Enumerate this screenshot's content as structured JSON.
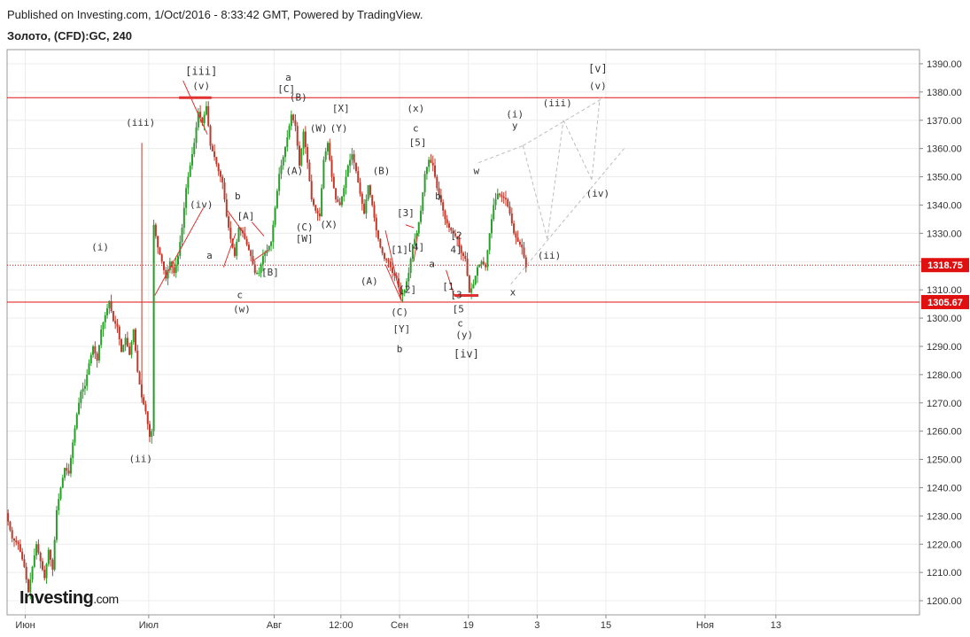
{
  "header": {
    "published": "Published on Investing.com, 1/Oct/2016 - 8:33:42 GMT, Powered by TradingView.",
    "symbol": "Золото, (CFD):GC, 240"
  },
  "logo": {
    "brand": "Investing",
    "suffix": ".com"
  },
  "colors": {
    "up": "#2a9d2a",
    "down": "#c0392b",
    "wave_line": "#e03030",
    "projection": "#bdbdbd",
    "price_tag": "#e01010",
    "grid": "#ececec",
    "axis": "#888888"
  },
  "chart_data": {
    "type": "candlestick",
    "ylim": [
      1195,
      1395
    ],
    "y_ticks": [
      1200,
      1210,
      1220,
      1230,
      1240,
      1250,
      1260,
      1270,
      1280,
      1290,
      1300,
      1310,
      1320,
      1330,
      1340,
      1350,
      1360,
      1370,
      1380,
      1390
    ],
    "y_tick_labels": [
      "1200.00",
      "1210.00",
      "1220.00",
      "1230.00",
      "1240.00",
      "1250.00",
      "1260.00",
      "1270.00",
      "1280.00",
      "1290.00",
      "1300.00",
      "1310.00",
      "1320.00",
      "1330.00",
      "1340.00",
      "1350.00",
      "1360.00",
      "1370.00",
      "1380.00",
      "1390.00"
    ],
    "x_labels": [
      {
        "label": "Июн",
        "x": 0.0
      },
      {
        "label": "Июл",
        "x": 30.5
      },
      {
        "label": "Авг",
        "x": 61.5
      },
      {
        "label": "12:00",
        "x": 78.0
      },
      {
        "label": "Сен",
        "x": 92.5
      },
      {
        "label": "19",
        "x": 109.5
      },
      {
        "label": "3",
        "x": 126.5
      },
      {
        "label": "15",
        "x": 143.5
      },
      {
        "label": "Ноя",
        "x": 168.0
      },
      {
        "label": "13",
        "x": 185.5
      }
    ],
    "x_range": [
      -4.5,
      221
    ],
    "price_path": [
      [
        -4.5,
        1231
      ],
      [
        -3,
        1222
      ],
      [
        -1.5,
        1220
      ],
      [
        0,
        1212
      ],
      [
        1,
        1203
      ],
      [
        2,
        1212
      ],
      [
        3,
        1220
      ],
      [
        4,
        1214
      ],
      [
        5,
        1208
      ],
      [
        6,
        1218
      ],
      [
        7,
        1211
      ],
      [
        8,
        1232
      ],
      [
        9,
        1240
      ],
      [
        10,
        1247
      ],
      [
        11,
        1245
      ],
      [
        12,
        1256
      ],
      [
        13,
        1266
      ],
      [
        14,
        1274
      ],
      [
        15,
        1276
      ],
      [
        16,
        1284
      ],
      [
        17,
        1290
      ],
      [
        18,
        1285
      ],
      [
        19,
        1296
      ],
      [
        20,
        1301
      ],
      [
        21,
        1306
      ],
      [
        22,
        1299
      ],
      [
        23,
        1297
      ],
      [
        24,
        1288
      ],
      [
        25,
        1293
      ],
      [
        26,
        1287
      ],
      [
        27,
        1296
      ],
      [
        28,
        1281
      ],
      [
        29,
        1272
      ],
      [
        30,
        1267
      ],
      [
        31,
        1258
      ],
      [
        31.5,
        1260
      ],
      [
        32,
        1333
      ],
      [
        33,
        1325
      ],
      [
        34,
        1320
      ],
      [
        35,
        1314
      ],
      [
        36,
        1320
      ],
      [
        37,
        1316
      ],
      [
        38,
        1322
      ],
      [
        39,
        1332
      ],
      [
        40,
        1346
      ],
      [
        41,
        1354
      ],
      [
        42,
        1362
      ],
      [
        43,
        1373
      ],
      [
        44,
        1369
      ],
      [
        45,
        1375
      ],
      [
        46,
        1361
      ],
      [
        47,
        1357
      ],
      [
        48,
        1352
      ],
      [
        49,
        1348
      ],
      [
        50,
        1336
      ],
      [
        51,
        1328
      ],
      [
        52,
        1322
      ],
      [
        53,
        1332
      ],
      [
        54,
        1330
      ],
      [
        55,
        1326
      ],
      [
        56,
        1322
      ],
      [
        57,
        1316
      ],
      [
        58,
        1316
      ],
      [
        59,
        1322
      ],
      [
        60,
        1324
      ],
      [
        61,
        1327
      ],
      [
        62,
        1339
      ],
      [
        63,
        1351
      ],
      [
        64,
        1357
      ],
      [
        65,
        1364
      ],
      [
        66,
        1372
      ],
      [
        67,
        1368
      ],
      [
        68,
        1354
      ],
      [
        69,
        1366
      ],
      [
        70,
        1355
      ],
      [
        71,
        1342
      ],
      [
        72,
        1338
      ],
      [
        73,
        1336
      ],
      [
        74,
        1356
      ],
      [
        75,
        1362
      ],
      [
        76,
        1350
      ],
      [
        77,
        1342
      ],
      [
        78,
        1340
      ],
      [
        79,
        1346
      ],
      [
        80,
        1354
      ],
      [
        81,
        1358
      ],
      [
        82,
        1352
      ],
      [
        83,
        1344
      ],
      [
        84,
        1337
      ],
      [
        85,
        1347
      ],
      [
        86,
        1340
      ],
      [
        87,
        1331
      ],
      [
        88,
        1325
      ],
      [
        89,
        1321
      ],
      [
        90,
        1320
      ],
      [
        91,
        1316
      ],
      [
        92,
        1314
      ],
      [
        93,
        1308
      ],
      [
        94,
        1310
      ],
      [
        95,
        1316
      ],
      [
        96,
        1326
      ],
      [
        97,
        1330
      ],
      [
        98,
        1338
      ],
      [
        99,
        1351
      ],
      [
        100,
        1356
      ],
      [
        101,
        1354
      ],
      [
        102,
        1346
      ],
      [
        103,
        1341
      ],
      [
        104,
        1335
      ],
      [
        105,
        1332
      ],
      [
        106,
        1330
      ],
      [
        107,
        1328
      ],
      [
        108,
        1323
      ],
      [
        109,
        1321
      ],
      [
        110,
        1309
      ],
      [
        111,
        1312
      ],
      [
        112,
        1318
      ],
      [
        113,
        1320
      ],
      [
        114,
        1318
      ],
      [
        115,
        1330
      ],
      [
        116,
        1340
      ],
      [
        117,
        1344
      ],
      [
        118,
        1343
      ],
      [
        119,
        1342
      ],
      [
        120,
        1337
      ],
      [
        121,
        1330
      ],
      [
        122,
        1327
      ],
      [
        123,
        1325
      ],
      [
        124,
        1318
      ]
    ],
    "price_tags": [
      {
        "label": "1318.75",
        "value": 1318.75,
        "style": "dotted"
      },
      {
        "label": "1305.67",
        "value": 1305.67,
        "style": "solid"
      }
    ],
    "h_lines": [
      {
        "value": 1378,
        "style": "solid"
      },
      {
        "value": 1318.75,
        "style": "dotted"
      },
      {
        "value": 1305.67,
        "style": "solid"
      }
    ],
    "wave_labels": [
      {
        "text": "[iii]",
        "x": 43.5,
        "y": 1386,
        "size": 12
      },
      {
        "text": "(v)",
        "x": 43.5,
        "y": 1381,
        "size": 11
      },
      {
        "text": "(iii)",
        "x": 28.5,
        "y": 1368,
        "size": 11
      },
      {
        "text": "(i)",
        "x": 18.5,
        "y": 1324,
        "size": 11
      },
      {
        "text": "(ii)",
        "x": 28.5,
        "y": 1249,
        "size": 11
      },
      {
        "text": "(iv)",
        "x": 43.5,
        "y": 1339,
        "size": 11
      },
      {
        "text": "a",
        "x": 45.5,
        "y": 1321,
        "size": 11
      },
      {
        "text": "b",
        "x": 52.5,
        "y": 1342,
        "size": 11
      },
      {
        "text": "[A]",
        "x": 54.5,
        "y": 1335,
        "size": 11
      },
      {
        "text": "[B]",
        "x": 60.5,
        "y": 1315,
        "size": 11
      },
      {
        "text": "c",
        "x": 53.0,
        "y": 1307,
        "size": 11
      },
      {
        "text": "(w)",
        "x": 53.5,
        "y": 1302,
        "size": 11
      },
      {
        "text": "a",
        "x": 65.0,
        "y": 1384,
        "size": 11
      },
      {
        "text": "[C]",
        "x": 64.5,
        "y": 1380,
        "size": 11
      },
      {
        "text": "(B)",
        "x": 67.5,
        "y": 1377,
        "size": 11
      },
      {
        "text": "(A)",
        "x": 66.5,
        "y": 1351,
        "size": 11
      },
      {
        "text": "(C)",
        "x": 69.0,
        "y": 1331,
        "size": 11
      },
      {
        "text": "[W]",
        "x": 69.0,
        "y": 1327,
        "size": 11
      },
      {
        "text": "(W)",
        "x": 72.5,
        "y": 1366,
        "size": 11
      },
      {
        "text": "(X)",
        "x": 75.0,
        "y": 1332,
        "size": 11
      },
      {
        "text": "[X]",
        "x": 78.0,
        "y": 1373,
        "size": 11
      },
      {
        "text": "(Y)",
        "x": 77.5,
        "y": 1366,
        "size": 11
      },
      {
        "text": "(B)",
        "x": 88.0,
        "y": 1351,
        "size": 11
      },
      {
        "text": "(A)",
        "x": 85.0,
        "y": 1312,
        "size": 11
      },
      {
        "text": "[3]",
        "x": 94.0,
        "y": 1336,
        "size": 11
      },
      {
        "text": "[1]",
        "x": 92.5,
        "y": 1323,
        "size": 11
      },
      {
        "text": "[4]",
        "x": 96.5,
        "y": 1324,
        "size": 11
      },
      {
        "text": "[2]",
        "x": 94.5,
        "y": 1309,
        "size": 11
      },
      {
        "text": "(C)",
        "x": 92.5,
        "y": 1301,
        "size": 11
      },
      {
        "text": "[Y]",
        "x": 93.0,
        "y": 1295,
        "size": 11
      },
      {
        "text": "b",
        "x": 92.5,
        "y": 1288,
        "size": 11
      },
      {
        "text": "(x)",
        "x": 96.5,
        "y": 1373,
        "size": 11
      },
      {
        "text": "c",
        "x": 96.5,
        "y": 1366,
        "size": 11
      },
      {
        "text": "[5]",
        "x": 97.0,
        "y": 1361,
        "size": 11
      },
      {
        "text": "b",
        "x": 102.0,
        "y": 1342,
        "size": 11
      },
      {
        "text": "a",
        "x": 100.5,
        "y": 1318,
        "size": 11
      },
      {
        "text": "[2",
        "x": 106.5,
        "y": 1328,
        "size": 11
      },
      {
        "text": "4]",
        "x": 106.5,
        "y": 1323,
        "size": 11
      },
      {
        "text": "[1",
        "x": 104.5,
        "y": 1310,
        "size": 11
      },
      {
        "text": "[3",
        "x": 106.5,
        "y": 1307,
        "size": 11
      },
      {
        "text": "[5",
        "x": 107.0,
        "y": 1302,
        "size": 11
      },
      {
        "text": "c",
        "x": 107.5,
        "y": 1297,
        "size": 11
      },
      {
        "text": "(y)",
        "x": 108.5,
        "y": 1293,
        "size": 11
      },
      {
        "text": "[iv]",
        "x": 109.0,
        "y": 1286,
        "size": 12
      },
      {
        "text": "w",
        "x": 111.5,
        "y": 1351,
        "size": 11
      },
      {
        "text": "x",
        "x": 120.5,
        "y": 1308,
        "size": 11
      },
      {
        "text": "(i)",
        "x": 121.0,
        "y": 1371,
        "size": 11
      },
      {
        "text": "y",
        "x": 121.0,
        "y": 1367,
        "size": 11
      },
      {
        "text": "(ii)",
        "x": 129.5,
        "y": 1321,
        "size": 11
      },
      {
        "text": "(iii)",
        "x": 131.5,
        "y": 1375,
        "size": 11
      },
      {
        "text": "(iv)",
        "x": 141.5,
        "y": 1343,
        "size": 11
      },
      {
        "text": "[v]",
        "x": 141.5,
        "y": 1387,
        "size": 12
      },
      {
        "text": "(v)",
        "x": 141.5,
        "y": 1381,
        "size": 11
      }
    ],
    "red_lines": [
      [
        [
          32,
          1308
        ],
        [
          44,
          1339
        ]
      ],
      [
        [
          39,
          1384
        ],
        [
          45,
          1365
        ]
      ],
      [
        [
          38,
          1378
        ],
        [
          46,
          1378
        ]
      ],
      [
        [
          50,
          1338
        ],
        [
          54,
          1330
        ]
      ],
      [
        [
          49,
          1318
        ],
        [
          52,
          1330
        ]
      ],
      [
        [
          56,
          1334
        ],
        [
          59,
          1329
        ]
      ],
      [
        [
          56,
          1320
        ],
        [
          60,
          1324
        ]
      ],
      [
        [
          89,
          1319
        ],
        [
          93,
          1306
        ]
      ],
      [
        [
          89,
          1331
        ],
        [
          93,
          1306
        ]
      ],
      [
        [
          94,
          1333
        ],
        [
          96,
          1332
        ]
      ],
      [
        [
          96,
          1320
        ],
        [
          97,
          1330
        ]
      ],
      [
        [
          104,
          1317
        ],
        [
          106,
          1308
        ]
      ],
      [
        [
          106,
          1308
        ],
        [
          112,
          1308
        ]
      ]
    ],
    "projection_lines": [
      [
        [
          112,
          1355
        ],
        [
          123,
          1361
        ]
      ],
      [
        [
          123,
          1361
        ],
        [
          129,
          1328
        ]
      ],
      [
        [
          129,
          1328
        ],
        [
          133,
          1370
        ]
      ],
      [
        [
          133,
          1370
        ],
        [
          140,
          1349
        ]
      ],
      [
        [
          140,
          1349
        ],
        [
          142,
          1378
        ]
      ],
      [
        [
          120,
          1312
        ],
        [
          148,
          1360
        ]
      ],
      [
        [
          123,
          1361
        ],
        [
          143,
          1378
        ]
      ]
    ]
  }
}
